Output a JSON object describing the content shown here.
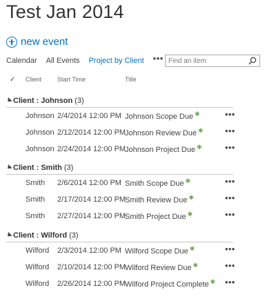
{
  "page": {
    "title": "Test Jan 2014"
  },
  "actions": {
    "new_event_label": "new event"
  },
  "views": {
    "items": [
      {
        "label": "Calendar",
        "active": false
      },
      {
        "label": "All Events",
        "active": false
      },
      {
        "label": "Project by Client",
        "active": true
      }
    ],
    "more_label": "•••"
  },
  "search": {
    "placeholder": "Find an item",
    "icon": "magnifier-icon"
  },
  "columns": {
    "check": "✓",
    "client": "Client",
    "start_time": "Start Time",
    "title": "Title"
  },
  "groups": [
    {
      "label": "Client : Johnson",
      "count": "(3)",
      "rows": [
        {
          "client": "Johnson",
          "start": "2/4/2014 12:00 PM",
          "title": "Johnson Scope Due"
        },
        {
          "client": "Johnson",
          "start": "2/12/2014 12:00 PM",
          "title": "Johnson Review Due"
        },
        {
          "client": "Johnson",
          "start": "2/24/2014 12:00 PM",
          "title": "Johnson Project Due"
        }
      ]
    },
    {
      "label": "Client : Smith",
      "count": "(3)",
      "rows": [
        {
          "client": "Smith",
          "start": "2/6/2014 12:00 PM",
          "title": "Smith Scope Due"
        },
        {
          "client": "Smith",
          "start": "2/17/2014 12:00 PM",
          "title": "Smith Review Due"
        },
        {
          "client": "Smith",
          "start": "2/27/2014 12:00 PM",
          "title": "Smith Project Due"
        }
      ]
    },
    {
      "label": "Client : Wilford",
      "count": "(3)",
      "rows": [
        {
          "client": "Wilford",
          "start": "2/3/2014 12:00 PM",
          "title": "Wilford Scope Due"
        },
        {
          "client": "Wilford",
          "start": "2/10/2014 12:00 PM",
          "title": "Wilford Review Due"
        },
        {
          "client": "Wilford",
          "start": "2/26/2014 12:00 PM",
          "title": "Wilford Project Complete"
        }
      ]
    }
  ],
  "row_menu_label": "•••",
  "colors": {
    "accent": "#0072c6",
    "new_badge": "#6aa84f"
  }
}
